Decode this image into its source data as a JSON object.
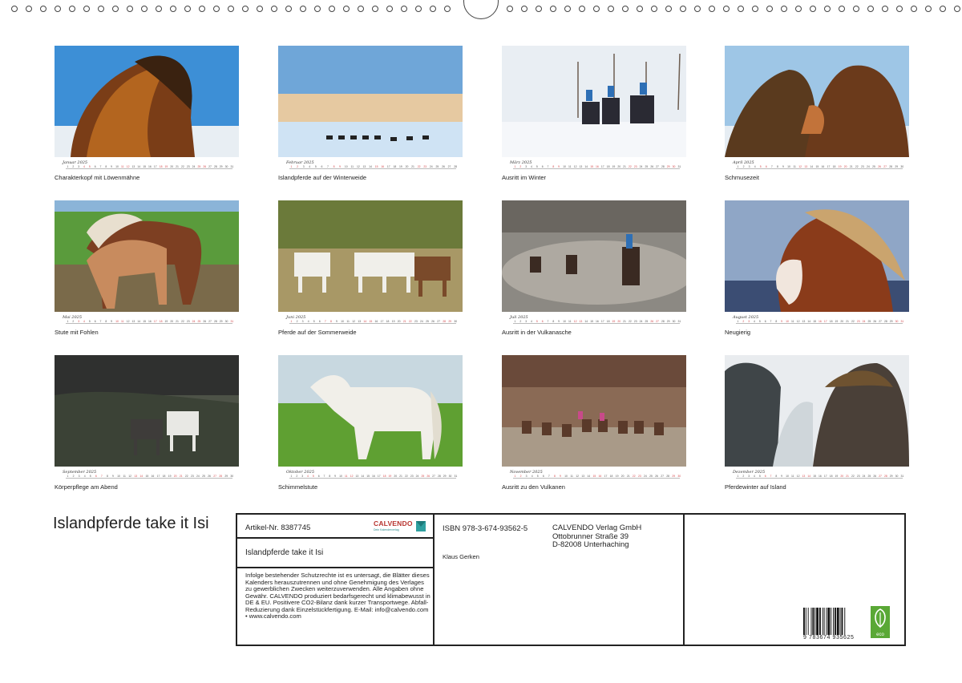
{
  "months": [
    {
      "name": "Januar 2025",
      "caption": "Charakterkopf mit Löwenmähne"
    },
    {
      "name": "Februar 2025",
      "caption": "Islandpferde auf der Winterweide"
    },
    {
      "name": "März 2025",
      "caption": "Ausritt im Winter"
    },
    {
      "name": "April 2025",
      "caption": "Schmusezeit"
    },
    {
      "name": "Mai 2025",
      "caption": "Stute mit Fohlen"
    },
    {
      "name": "Juni 2025",
      "caption": "Pferde auf der Sommerweide"
    },
    {
      "name": "Juli 2025",
      "caption": "Ausritt in der Vulkanasche"
    },
    {
      "name": "August 2025",
      "caption": "Neugierig"
    },
    {
      "name": "September 2025",
      "caption": "Körperpflege am Abend"
    },
    {
      "name": "Oktober 2025",
      "caption": "Schimmelstute"
    },
    {
      "name": "November 2025",
      "caption": "Ausritt zu den Vulkanen"
    },
    {
      "name": "Dezember 2025",
      "caption": "Pferdewinter auf Island"
    }
  ],
  "colors": {
    "weekend": "#d4484b",
    "brand": "#b8332e",
    "eco": "#5aa836"
  },
  "info": {
    "title": "Islandpferde take it Isi",
    "article": "Artikel-Nr. 8387745",
    "logo": "CALVENDO",
    "logo_sub": "Dein Kalenderverlag",
    "subtitle": "Islandpferde take it Isi",
    "legal": "Infolge bestehender Schutzrechte ist es untersagt, die Blätter dieses Kalenders herauszutrennen und ohne Genehmigung des Verlages zu gewerblichen Zwecken weiterzuverwenden. Alle Angaben ohne Gewähr. CALVENDO produziert bedarfsgerecht und klimabewusst in DE & EU. Positivere CO2-Bilanz dank kurzer Transportwege. Abfall-Reduzierung dank Einzelstückfertigung. E-Mail: info@calvendo.com • www.calvendo.com",
    "isbn": "ISBN 978-3-674-93562-5",
    "author": "Klaus Gerken",
    "publisher_line1": "CALVENDO Verlag GmbH",
    "publisher_line2": "Ottobrunner Straße 39",
    "publisher_line3": "D-82008 Unterhaching",
    "barcode_number": "9 783674 935625",
    "eco_label": "eco"
  }
}
